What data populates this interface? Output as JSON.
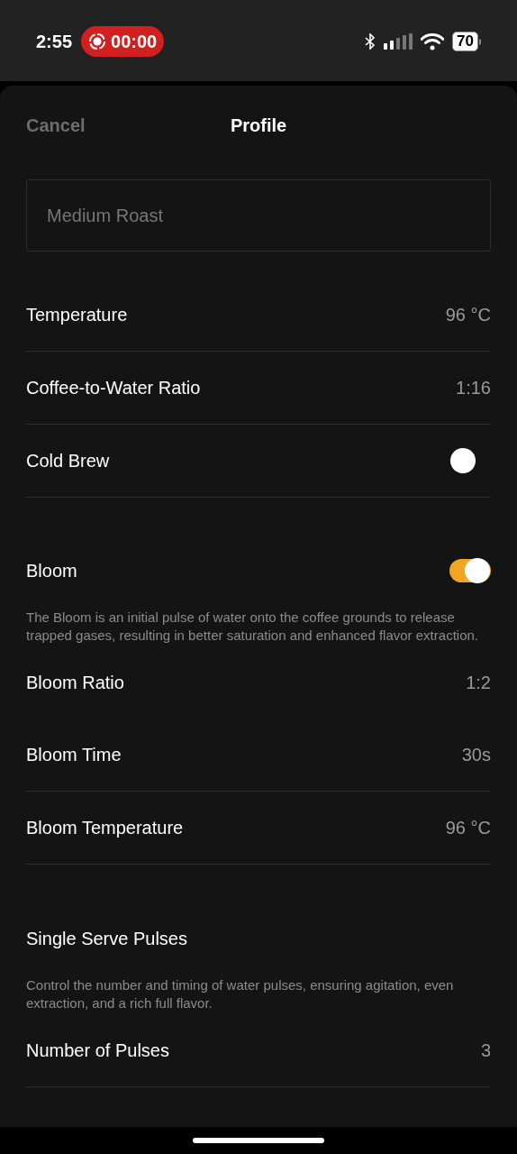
{
  "status_bar": {
    "time": "2:55",
    "recording": "00:00",
    "battery": "70"
  },
  "header": {
    "cancel": "Cancel",
    "title": "Profile"
  },
  "name_field": {
    "placeholder": "Medium Roast"
  },
  "rows": [
    {
      "kind": "value",
      "label": "Temperature",
      "value": "96 °C",
      "divider": true
    },
    {
      "kind": "value",
      "label": "Coffee-to-Water Ratio",
      "value": "1:16",
      "divider": true
    },
    {
      "kind": "toggle",
      "label": "Cold Brew",
      "on": false,
      "divider": true
    },
    {
      "kind": "toggle",
      "label": "Bloom",
      "on": true,
      "divider": false
    },
    {
      "kind": "description",
      "text": "The Bloom is an initial pulse of water onto the coffee grounds to release trapped gases, resulting in better saturation and enhanced flavor extraction."
    },
    {
      "kind": "value",
      "label": "Bloom Ratio",
      "value": "1:2",
      "divider": false
    },
    {
      "kind": "value",
      "label": "Bloom Time",
      "value": "30s",
      "divider": true
    },
    {
      "kind": "value",
      "label": "Bloom Temperature",
      "value": "96 °C",
      "divider": true
    },
    {
      "kind": "heading",
      "label": "Single Serve Pulses"
    },
    {
      "kind": "description",
      "text": "Control the number and timing of water pulses, ensuring agitation, even extraction, and a rich full flavor."
    },
    {
      "kind": "value",
      "label": "Number of Pulses",
      "value": "3",
      "divider": true
    }
  ]
}
